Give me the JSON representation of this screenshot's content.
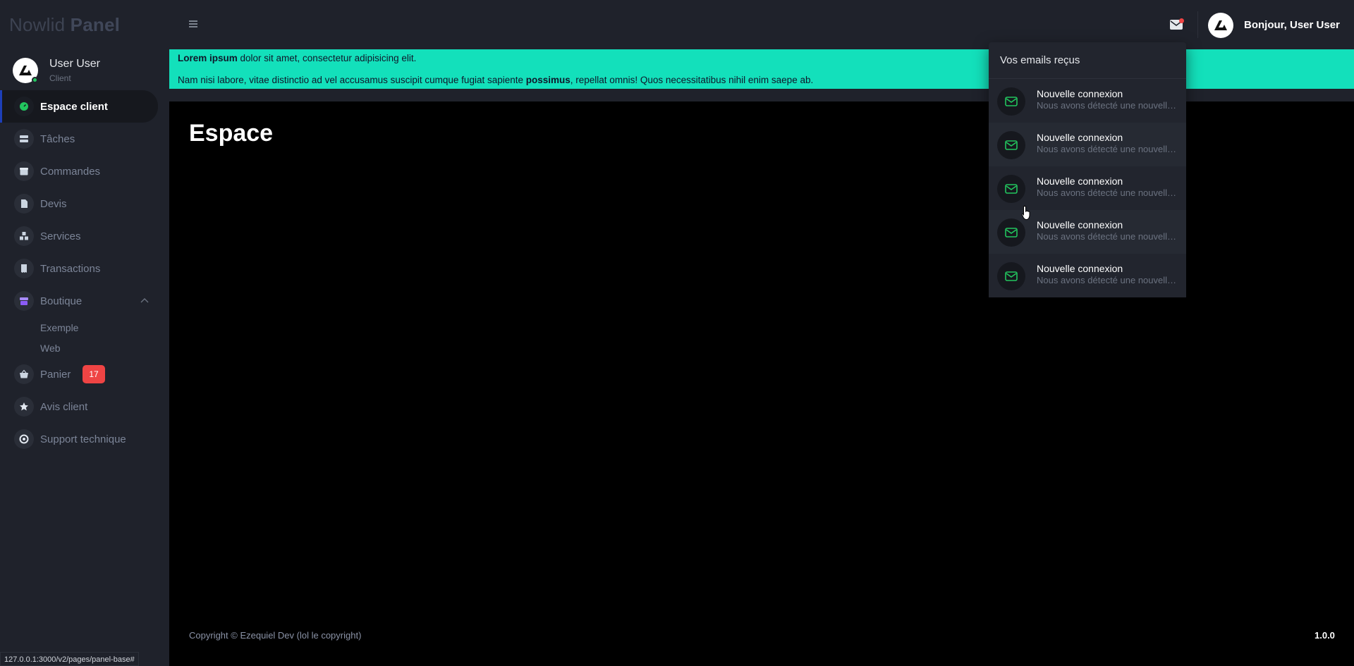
{
  "brand": {
    "name_light": "Nowlid",
    "name_bold": "Panel"
  },
  "user": {
    "name": "User User",
    "role": "Client"
  },
  "sidebar": {
    "items": [
      {
        "label": "Espace client",
        "icon": "dashboard-icon",
        "active": true
      },
      {
        "label": "Tâches",
        "icon": "tasks-icon"
      },
      {
        "label": "Commandes",
        "icon": "box-icon"
      },
      {
        "label": "Devis",
        "icon": "file-icon"
      },
      {
        "label": "Services",
        "icon": "cubes-icon"
      },
      {
        "label": "Transactions",
        "icon": "receipt-icon"
      },
      {
        "label": "Boutique",
        "icon": "store-icon",
        "expanded": true,
        "children": [
          {
            "label": "Exemple"
          },
          {
            "label": "Web"
          }
        ]
      },
      {
        "label": "Panier",
        "icon": "basket-icon",
        "badge": "17"
      },
      {
        "label": "Avis client",
        "icon": "star-icon"
      },
      {
        "label": "Support technique",
        "icon": "lifebuoy-icon"
      }
    ]
  },
  "topbar": {
    "greeting": "Bonjour, User User"
  },
  "alert": {
    "line1_bold": "Lorem ipsum",
    "line1_rest": " dolor sit amet, consectetur adipisicing elit.",
    "line2_start": "Nam nisi labore, vitae distinctio ad vel accusamus suscipit cumque fugiat sapiente ",
    "line2_bold": "possimus",
    "line2_end": ", repellat omnis! Quos necessitatibus nihil enim saepe ab."
  },
  "main": {
    "title": "Espace"
  },
  "emails": {
    "title": "Vos emails reçus",
    "items": [
      {
        "subject": "Nouvelle connexion",
        "preview": "Nous avons détecté une nouvelle connexion"
      },
      {
        "subject": "Nouvelle connexion",
        "preview": "Nous avons détecté une nouvelle connexion"
      },
      {
        "subject": "Nouvelle connexion",
        "preview": "Nous avons détecté une nouvelle connexion"
      },
      {
        "subject": "Nouvelle connexion",
        "preview": "Nous avons détecté une nouvelle connexion"
      },
      {
        "subject": "Nouvelle connexion",
        "preview": "Nous avons détecté une nouvelle connexion"
      }
    ]
  },
  "footer": {
    "copyright": "Copyright © Ezequiel Dev (lol le copyright)",
    "version": "1.0.0"
  },
  "status_url": "127.0.0.1:3000/v2/pages/panel-base#",
  "colors": {
    "accent": "#13e0bb",
    "mail_icon": "#22c55e",
    "badge": "#ef4444",
    "active_border": "#1d3fb8"
  }
}
